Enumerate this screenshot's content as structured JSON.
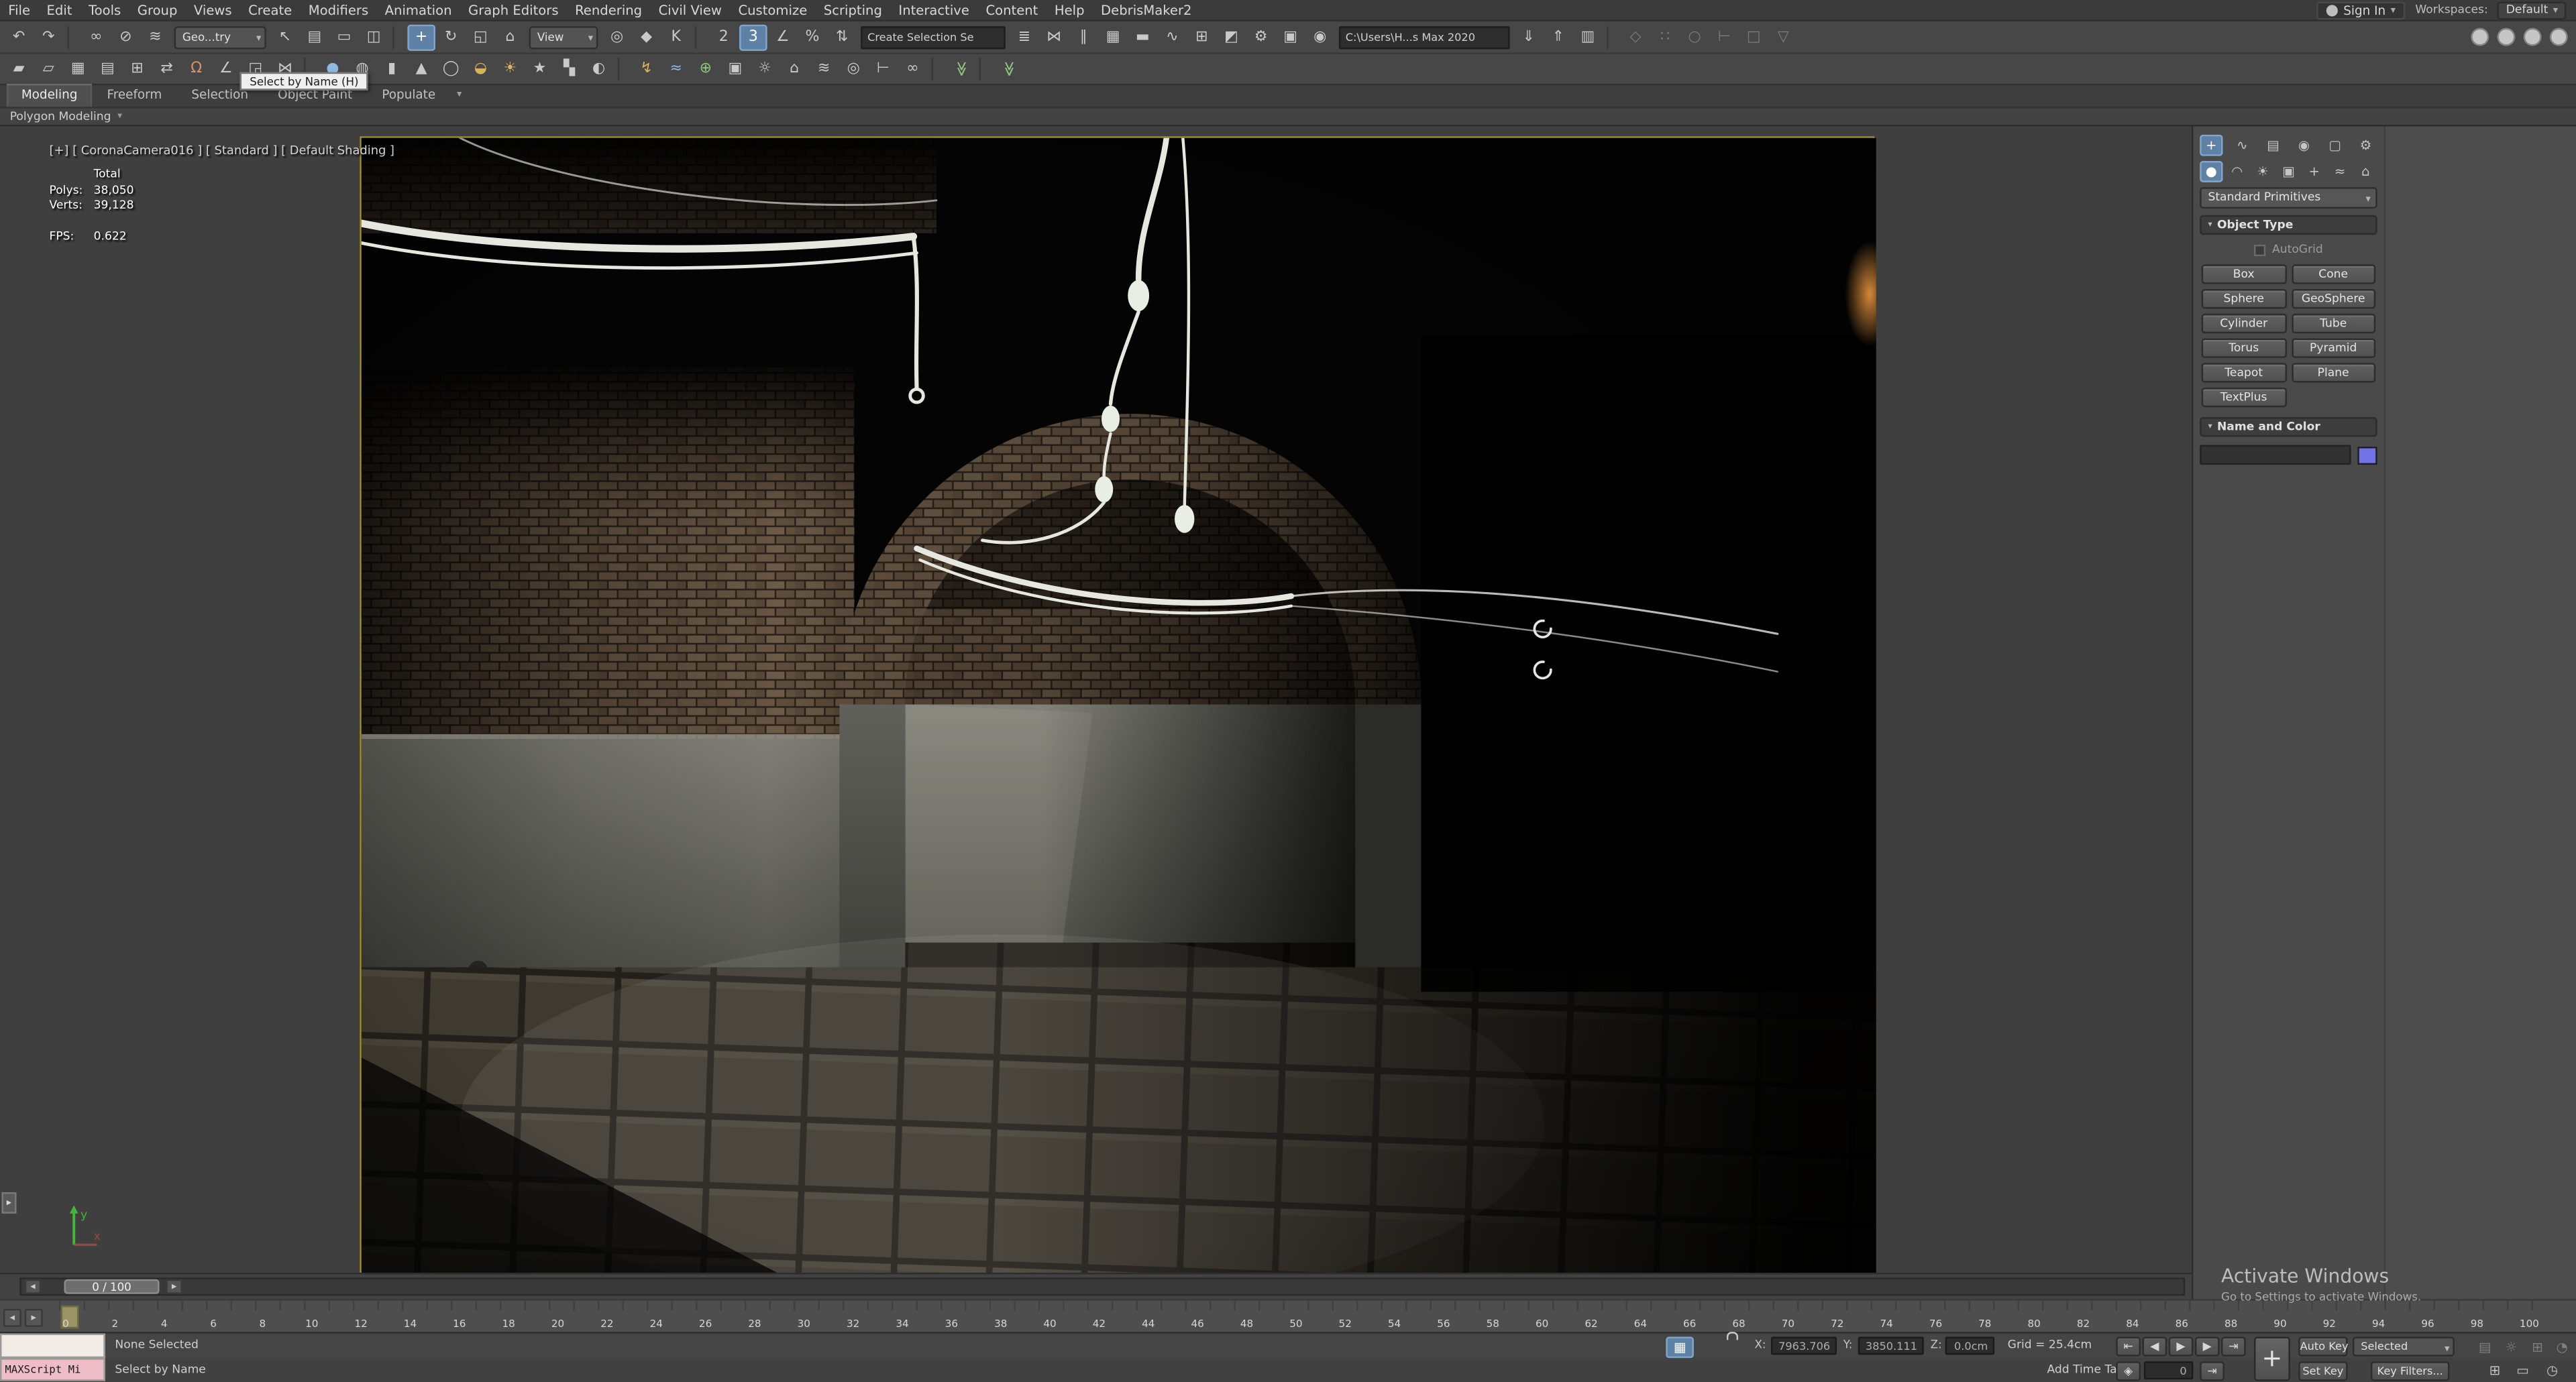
{
  "colors": {
    "accent_blue": "#5f81a5",
    "viewport_border": "#a39428",
    "object_color_swatch": "#7373e8",
    "maxscript_pink": "#eebdc8"
  },
  "menu": {
    "items": [
      "File",
      "Edit",
      "Tools",
      "Group",
      "Views",
      "Create",
      "Modifiers",
      "Animation",
      "Graph Editors",
      "Rendering",
      "Civil View",
      "Customize",
      "Scripting",
      "Interactive",
      "Content",
      "Help",
      "DebrisMaker2"
    ],
    "sign_in": "Sign In",
    "workspaces_label": "Workspaces:",
    "workspaces_value": "Default"
  },
  "toolbar1": {
    "items": [
      {
        "n": "undo-icon",
        "cls": "ti",
        "txt": "↶"
      },
      {
        "n": "redo-icon",
        "cls": "ti",
        "txt": "↷"
      },
      {
        "n": "toolbar-separator",
        "cls": "tsep",
        "txt": "",
        "i": "false"
      },
      {
        "n": "select-and-link-icon",
        "cls": "ti",
        "txt": "∞"
      },
      {
        "n": "unlink-selection-icon",
        "cls": "ti",
        "txt": "⊘"
      },
      {
        "n": "bind-to-space-warp-icon",
        "cls": "ti",
        "txt": "≋"
      },
      {
        "n": "selection-filter-dropdown",
        "cls": "tdd w56",
        "txt": "Geo...try"
      },
      {
        "n": "select-object-icon",
        "cls": "ti",
        "txt": "↖"
      },
      {
        "n": "select-by-name-icon",
        "cls": "ti",
        "txt": "▤"
      },
      {
        "n": "rectangular-selection-icon",
        "cls": "ti",
        "txt": "▭"
      },
      {
        "n": "window-crossing-icon",
        "cls": "ti",
        "txt": "◫"
      },
      {
        "n": "toolbar-separator",
        "cls": "tsep",
        "txt": "",
        "i": "false"
      },
      {
        "n": "select-and-move-icon",
        "cls": "ti on",
        "txt": "+"
      },
      {
        "n": "select-and-rotate-icon",
        "cls": "ti",
        "txt": "↻"
      },
      {
        "n": "select-and-scale-icon",
        "cls": "ti",
        "txt": "◱"
      },
      {
        "n": "select-and-place-icon",
        "cls": "ti",
        "txt": "⌂"
      },
      {
        "n": "reference-coordinate-dropdown",
        "cls": "tdd w42",
        "txt": "View"
      },
      {
        "n": "use-pivot-point-icon",
        "cls": "ti",
        "txt": "◎"
      },
      {
        "n": "select-and-manipulate-icon",
        "cls": "ti",
        "txt": "◆"
      },
      {
        "n": "keyboard-shortcut-override-icon",
        "cls": "ti",
        "txt": "K"
      },
      {
        "n": "toolbar-separator",
        "cls": "tsep",
        "txt": "",
        "i": "false"
      },
      {
        "n": "snaps-toggle-2d-icon",
        "cls": "ti",
        "txt": "2"
      },
      {
        "n": "snaps-toggle-3d-icon",
        "cls": "ti on",
        "txt": "3"
      },
      {
        "n": "angle-snap-icon",
        "cls": "ti",
        "txt": "∠"
      },
      {
        "n": "percent-snap-icon",
        "cls": "ti",
        "txt": "%"
      },
      {
        "n": "spinner-snap-icon",
        "cls": "ti",
        "txt": "⇅"
      },
      {
        "n": "named-selection-set-field",
        "cls": "tfld w88",
        "txt": "Create Selection Se"
      },
      {
        "n": "edit-named-selections-icon",
        "cls": "ti",
        "txt": "≣"
      },
      {
        "n": "mirror-icon",
        "cls": "ti",
        "txt": "⋈"
      },
      {
        "n": "align-icon",
        "cls": "ti",
        "txt": "∥"
      },
      {
        "n": "toggle-scene-explorer-icon",
        "cls": "ti",
        "txt": "▦"
      },
      {
        "n": "toggle-ribbon-icon",
        "cls": "ti",
        "txt": "▬"
      },
      {
        "n": "curve-editor-icon",
        "cls": "ti",
        "txt": "∿"
      },
      {
        "n": "schematic-view-icon",
        "cls": "ti",
        "txt": "⊞"
      },
      {
        "n": "material-editor-icon",
        "cls": "ti",
        "txt": "◩"
      },
      {
        "n": "render-setup-icon",
        "cls": "ti",
        "txt": "⚙"
      },
      {
        "n": "rendered-frame-window-icon",
        "cls": "ti",
        "txt": "▣"
      },
      {
        "n": "render-production-icon",
        "cls": "ti",
        "txt": "◉"
      },
      {
        "n": "project-folder-field",
        "cls": "tfld w104",
        "txt": "C:\\Users\\H...s Max 2020"
      },
      {
        "n": "import-asset-icon",
        "cls": "ti",
        "txt": "⇓"
      },
      {
        "n": "export-asset-icon",
        "cls": "ti",
        "txt": "⇑"
      },
      {
        "n": "asset-library-icon",
        "cls": "ti",
        "txt": "▥"
      },
      {
        "n": "toolbar-separator",
        "cls": "tsep",
        "txt": "",
        "i": "false"
      },
      {
        "n": "transform-toolbox-icon",
        "cls": "ti dim",
        "txt": "◇"
      },
      {
        "n": "array-tool-icon",
        "cls": "ti dim",
        "txt": "∷"
      },
      {
        "n": "snapshot-icon",
        "cls": "ti dim",
        "txt": "○"
      },
      {
        "n": "measure-distance-icon",
        "cls": "ti dim",
        "txt": "⊢"
      },
      {
        "n": "isolate-selection-icon",
        "cls": "ti dim",
        "txt": "□"
      },
      {
        "n": "display-floater-icon",
        "cls": "ti dim",
        "txt": "▽"
      },
      {
        "n": "toolbar-spacer",
        "cls": "tspace",
        "txt": "",
        "i": "false"
      },
      {
        "n": "window-minimize-icon",
        "cls": "circ",
        "txt": ""
      },
      {
        "n": "window-restore-icon",
        "cls": "circ",
        "txt": ""
      },
      {
        "n": "window-close-icon",
        "cls": "circ",
        "txt": ""
      },
      {
        "n": "info-center-icon",
        "cls": "circ",
        "txt": ""
      }
    ]
  },
  "toolbar2": {
    "items": [
      {
        "n": "polygon-draw-icon",
        "cls": "ti",
        "txt": "▰"
      },
      {
        "n": "plane-primitive-icon",
        "cls": "ti",
        "txt": "▱"
      },
      {
        "n": "box-primitive-icon",
        "cls": "ti",
        "txt": "▦"
      },
      {
        "n": "panel-list-icon",
        "cls": "ti",
        "txt": "▤"
      },
      {
        "n": "grid-helper-icon",
        "cls": "ti",
        "txt": "⊞"
      },
      {
        "n": "swap-tool-icon",
        "cls": "ti",
        "txt": "⇄"
      },
      {
        "n": "magnet-snap-icon",
        "cls": "ti c-red",
        "txt": "Ω"
      },
      {
        "n": "angle-measure-icon",
        "cls": "ti",
        "txt": "∠"
      },
      {
        "n": "scale-region-icon",
        "cls": "ti",
        "txt": "◲"
      },
      {
        "n": "mirror-tool-icon",
        "cls": "ti",
        "txt": "⋈"
      },
      {
        "n": "toolbar-separator",
        "cls": "tsep",
        "txt": "",
        "i": "false"
      },
      {
        "n": "sphere-primitive-icon",
        "cls": "ti c-blue",
        "txt": "●"
      },
      {
        "n": "geosphere-primitive-icon",
        "cls": "ti",
        "txt": "◍"
      },
      {
        "n": "cylinder-primitive-icon",
        "cls": "ti",
        "txt": "▮"
      },
      {
        "n": "cone-primitive-icon",
        "cls": "ti",
        "txt": "▲"
      },
      {
        "n": "torus-primitive-icon",
        "cls": "ti",
        "txt": "◯"
      },
      {
        "n": "teapot-primitive-icon",
        "cls": "ti c-gold",
        "txt": "◒"
      },
      {
        "n": "omni-light-icon",
        "cls": "ti c-gold",
        "txt": "☀"
      },
      {
        "n": "star-shape-icon",
        "cls": "ti",
        "txt": "★"
      },
      {
        "n": "checker-map-icon",
        "cls": "ti",
        "txt": "▚"
      },
      {
        "n": "sphere-map-icon",
        "cls": "ti",
        "txt": "◐"
      },
      {
        "n": "toolbar-separator",
        "cls": "tsep",
        "txt": "",
        "i": "false"
      },
      {
        "n": "lightning-tool-icon",
        "cls": "ti c-gold",
        "txt": "↯"
      },
      {
        "n": "wave-modifier-icon",
        "cls": "ti c-blue",
        "txt": "≈"
      },
      {
        "n": "globe-tool-icon",
        "cls": "ti c-green",
        "txt": "⊕"
      },
      {
        "n": "camera-create-icon",
        "cls": "ti",
        "txt": "▣"
      },
      {
        "n": "light-create-icon",
        "cls": "ti",
        "txt": "☼"
      },
      {
        "n": "helper-create-icon",
        "cls": "ti",
        "txt": "⌂"
      },
      {
        "n": "space-warp-icon",
        "cls": "ti",
        "txt": "≋"
      },
      {
        "n": "target-tool-icon",
        "cls": "ti",
        "txt": "◎"
      },
      {
        "n": "measure-tool-icon",
        "cls": "ti",
        "txt": "⊢"
      },
      {
        "n": "link-tool-icon",
        "cls": "ti",
        "txt": "∞"
      },
      {
        "n": "toolbar-separator",
        "cls": "tsep",
        "txt": "",
        "i": "false"
      },
      {
        "n": "apply-check-icon",
        "cls": "ti c-green rot90",
        "txt": "≫"
      },
      {
        "n": "toolbar-separator",
        "cls": "tsep",
        "txt": "",
        "i": "false"
      },
      {
        "n": "expand-all-icon",
        "cls": "ti c-green rot90",
        "txt": "≫"
      }
    ]
  },
  "ribbon": {
    "tabs": [
      {
        "label": "Modeling",
        "cls": "rtab on"
      },
      {
        "label": "Freeform",
        "cls": "rtab"
      },
      {
        "label": "Selection",
        "cls": "rtab"
      },
      {
        "label": "Object Paint",
        "cls": "rtab"
      },
      {
        "label": "Populate",
        "cls": "rtab"
      }
    ],
    "extra": "▾",
    "panel_label": "Polygon Modeling",
    "panel_caret": "▾"
  },
  "tooltip": {
    "text": "Select by Name  (H)"
  },
  "viewport": {
    "label": "[+] [ CoronaCamera016 ] [ Standard ] [ Default Shading ]",
    "stats": {
      "total_header": "Total",
      "polys_label": "Polys:",
      "polys_value": "38,050",
      "verts_label": "Verts:",
      "verts_value": "39,128",
      "fps_label": "FPS:",
      "fps_value": "0.622"
    },
    "tab_glyph": "▸",
    "axis_y_label": "y",
    "axis_x_label": "x"
  },
  "command_panel": {
    "tabs": [
      {
        "n": "create-tab-icon",
        "cls": "cpi on",
        "txt": "+"
      },
      {
        "n": "modify-tab-icon",
        "cls": "cpi",
        "txt": "∿"
      },
      {
        "n": "hierarchy-tab-icon",
        "cls": "cpi",
        "txt": "▤"
      },
      {
        "n": "motion-tab-icon",
        "cls": "cpi",
        "txt": "◉"
      },
      {
        "n": "display-tab-icon",
        "cls": "cpi",
        "txt": "▢"
      },
      {
        "n": "utilities-tab-icon",
        "cls": "cpi",
        "txt": "⚙"
      }
    ],
    "categories": [
      {
        "n": "geometry-category-icon",
        "cls": "cpi on",
        "txt": "●"
      },
      {
        "n": "shapes-category-icon",
        "cls": "cpi",
        "txt": "◠"
      },
      {
        "n": "lights-category-icon",
        "cls": "cpi",
        "txt": "☀"
      },
      {
        "n": "cameras-category-icon",
        "cls": "cpi",
        "txt": "▣"
      },
      {
        "n": "helpers-category-icon",
        "cls": "cpi",
        "txt": "+"
      },
      {
        "n": "space-warps-category-icon",
        "cls": "cpi",
        "txt": "≈"
      },
      {
        "n": "systems-category-icon",
        "cls": "cpi",
        "txt": "⌂"
      }
    ],
    "category_dropdown": "Standard Primitives",
    "object_type": {
      "title": "Object Type",
      "tri": "▾",
      "autogrid_label": "AutoGrid",
      "buttons": [
        "Box",
        "Cone",
        "Sphere",
        "GeoSphere",
        "Cylinder",
        "Tube",
        "Torus",
        "Pyramid",
        "Teapot",
        "Plane",
        "TextPlus"
      ]
    },
    "name_color": {
      "title": "Name and Color",
      "tri": "▾",
      "swatch_color": "#7373e8"
    }
  },
  "watermark": {
    "line1": "Activate Windows",
    "line2": "Go to Settings to activate Windows."
  },
  "timeline": {
    "slider_value": "0 / 100",
    "prev_glyph": "◂",
    "next_glyph": "▸",
    "ticks": [
      "0",
      "2",
      "4",
      "6",
      "8",
      "10",
      "12",
      "14",
      "16",
      "18",
      "20",
      "22",
      "24",
      "26",
      "28",
      "30",
      "32",
      "34",
      "36",
      "38",
      "40",
      "42",
      "44",
      "46",
      "48",
      "50",
      "52",
      "54",
      "56",
      "58",
      "60",
      "62",
      "64",
      "66",
      "68",
      "70",
      "72",
      "74",
      "76",
      "78",
      "80",
      "82",
      "84",
      "86",
      "88",
      "90",
      "92",
      "94",
      "96",
      "98",
      "100"
    ]
  },
  "status": {
    "maxscript_label": "MAXScript Mi",
    "selection_status": "None Selected",
    "prompt": "Select by Name",
    "x_label": "X:",
    "x_value": "7963.706",
    "y_label": "Y:",
    "y_value": "3850.111",
    "z_label": "Z:",
    "z_value": "0.0cm",
    "grid_text": "Grid = 25.4cm",
    "add_time_tag": "Add Time Tag",
    "frame_field": "0",
    "auto_key": "Auto Key",
    "set_key": "Set Key",
    "selected_dropdown": "Selected",
    "key_filters": "Key Filters...",
    "big_key_glyph": "+",
    "transport_r1": [
      {
        "n": "go-to-start-button",
        "cls": "tbtn",
        "txt": "⇤"
      },
      {
        "n": "previous-frame-button",
        "cls": "tbtn",
        "txt": "◀"
      },
      {
        "n": "play-animation-button",
        "cls": "tbtn",
        "txt": "▶"
      },
      {
        "n": "next-frame-button",
        "cls": "tbtn",
        "txt": "▶"
      },
      {
        "n": "go-to-end-button",
        "cls": "tbtn",
        "txt": "⇥"
      }
    ],
    "key_mode_glyph": "◈",
    "next_key_glyph": "⇥",
    "icons_left": [
      {
        "n": "viewport-layout-icon",
        "cls": "sic on",
        "txt": "▦"
      }
    ],
    "icons_r1": [
      {
        "n": "notifications-icon",
        "cls": "sic dim",
        "txt": "▤"
      },
      {
        "n": "communicate-icon",
        "cls": "sic dim",
        "txt": "☼"
      },
      {
        "n": "layers-status-icon",
        "cls": "sic dim",
        "txt": "⊞"
      },
      {
        "n": "time-config-icon",
        "cls": "sic dim",
        "txt": "◔"
      }
    ],
    "icons_r2": [
      {
        "n": "grid-toggle-icon",
        "cls": "sic c-green",
        "txt": "⊞"
      },
      {
        "n": "safe-frame-icon",
        "cls": "sic c-gold",
        "txt": "▭"
      },
      {
        "n": "time-configuration-icon",
        "cls": "sic",
        "txt": "◷"
      }
    ]
  }
}
